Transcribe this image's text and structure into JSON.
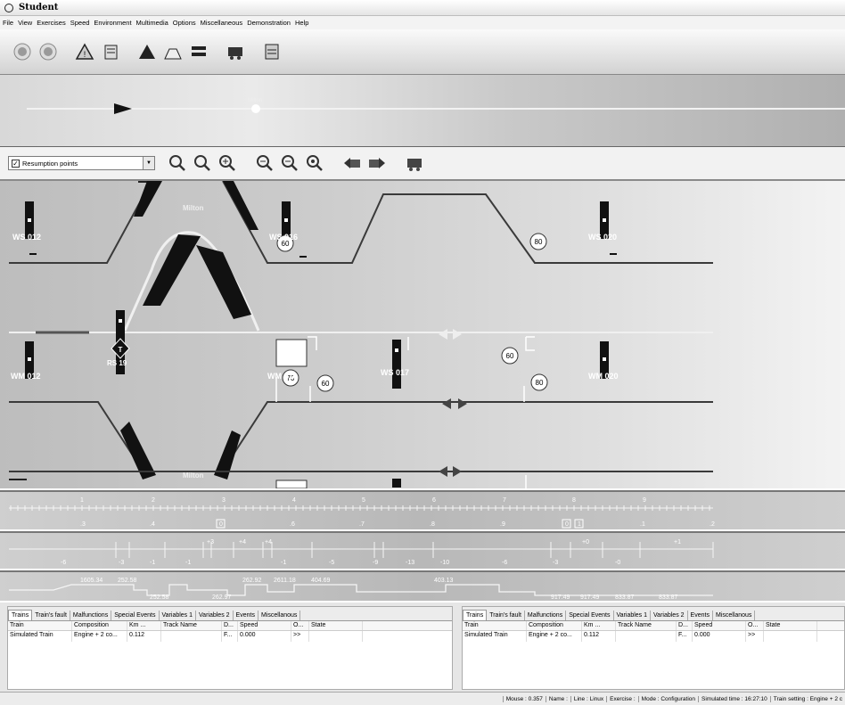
{
  "window": {
    "title": "Student"
  },
  "menu": [
    "File",
    "View",
    "Exercises",
    "Speed",
    "Environment",
    "Multimedia",
    "Options",
    "Miscellaneous",
    "Demonstration",
    "Help"
  ],
  "overview": {
    "marker_label": "Milton"
  },
  "dropdown": {
    "label": "Resumption points"
  },
  "schematic": {
    "labels": {
      "milton_top": "Milton",
      "milton_bottom": "Milton",
      "ws012": "WS 012",
      "ws016": "WS 016",
      "ws020": "WS 020",
      "wm012": "WM 012",
      "wm016": "WM 016",
      "ws017": "WS 017",
      "wm020": "WM 020",
      "rs19": "RS 19",
      "t_marker": "T"
    },
    "speed_limits": [
      "60",
      "80",
      "70",
      "60",
      "60",
      "80"
    ]
  },
  "ruler": {
    "top": [
      "1",
      "2",
      "3",
      "4",
      "5",
      "6",
      "7",
      "8",
      "9"
    ],
    "bottom": [
      ".3",
      ".4",
      "0",
      ".6",
      ".7",
      ".8",
      ".9",
      "0",
      "1",
      ".1",
      ".2"
    ]
  },
  "gradient": {
    "values": [
      "-6",
      "-3",
      "-1",
      "-1",
      "+3",
      "+4",
      "+4",
      "-1",
      "-5",
      "-9",
      "-13",
      "-10",
      "-6",
      "-3",
      "+0",
      "-0",
      "+1"
    ]
  },
  "profile": {
    "values": [
      "1605.34",
      "252.58",
      "252.58",
      "262.97",
      "262.92",
      "2611.18",
      "404.69",
      "403.13",
      "917.49",
      "917.49",
      "833.87",
      "833.87"
    ]
  },
  "panels": [
    {
      "tabs": [
        "Trains",
        "Train's fault",
        "Malfunctions",
        "Special Events",
        "Variables 1",
        "Variables 2",
        "Events",
        "Miscellanous"
      ],
      "columns": [
        "Train",
        "Composition",
        "Km ...",
        "Track Name",
        "D...",
        "Speed",
        "O...",
        "State"
      ],
      "rows": [
        {
          "train": "Simulated Train",
          "composition": "Engine + 2 co...",
          "km": "0.112",
          "track": "",
          "d": "F...",
          "speed": "0.000",
          "o": ">>",
          "state": ""
        }
      ]
    },
    {
      "tabs": [
        "Trains",
        "Train's fault",
        "Malfunctions",
        "Special Events",
        "Variables 1",
        "Variables 2",
        "Events",
        "Miscellanous"
      ],
      "columns": [
        "Train",
        "Composition",
        "Km ...",
        "Track Name",
        "D...",
        "Speed",
        "O...",
        "State"
      ],
      "rows": [
        {
          "train": "Simulated Train",
          "composition": "Engine + 2 co...",
          "km": "0.112",
          "track": "",
          "d": "F...",
          "speed": "0.000",
          "o": ">>",
          "state": ""
        }
      ]
    }
  ],
  "status": {
    "mouse": "Mouse : 0.357",
    "name": "Name :",
    "line": "Line : Linux",
    "exercise": "Exercise :",
    "mode": "Mode : Configuration",
    "simtime": "Simulated time : 16:27:10",
    "setting": "Train setting : Engine + 2 c"
  },
  "colors": {
    "track": "#3a3a3a",
    "signal": "#111111",
    "background": "#c8c8c8"
  }
}
